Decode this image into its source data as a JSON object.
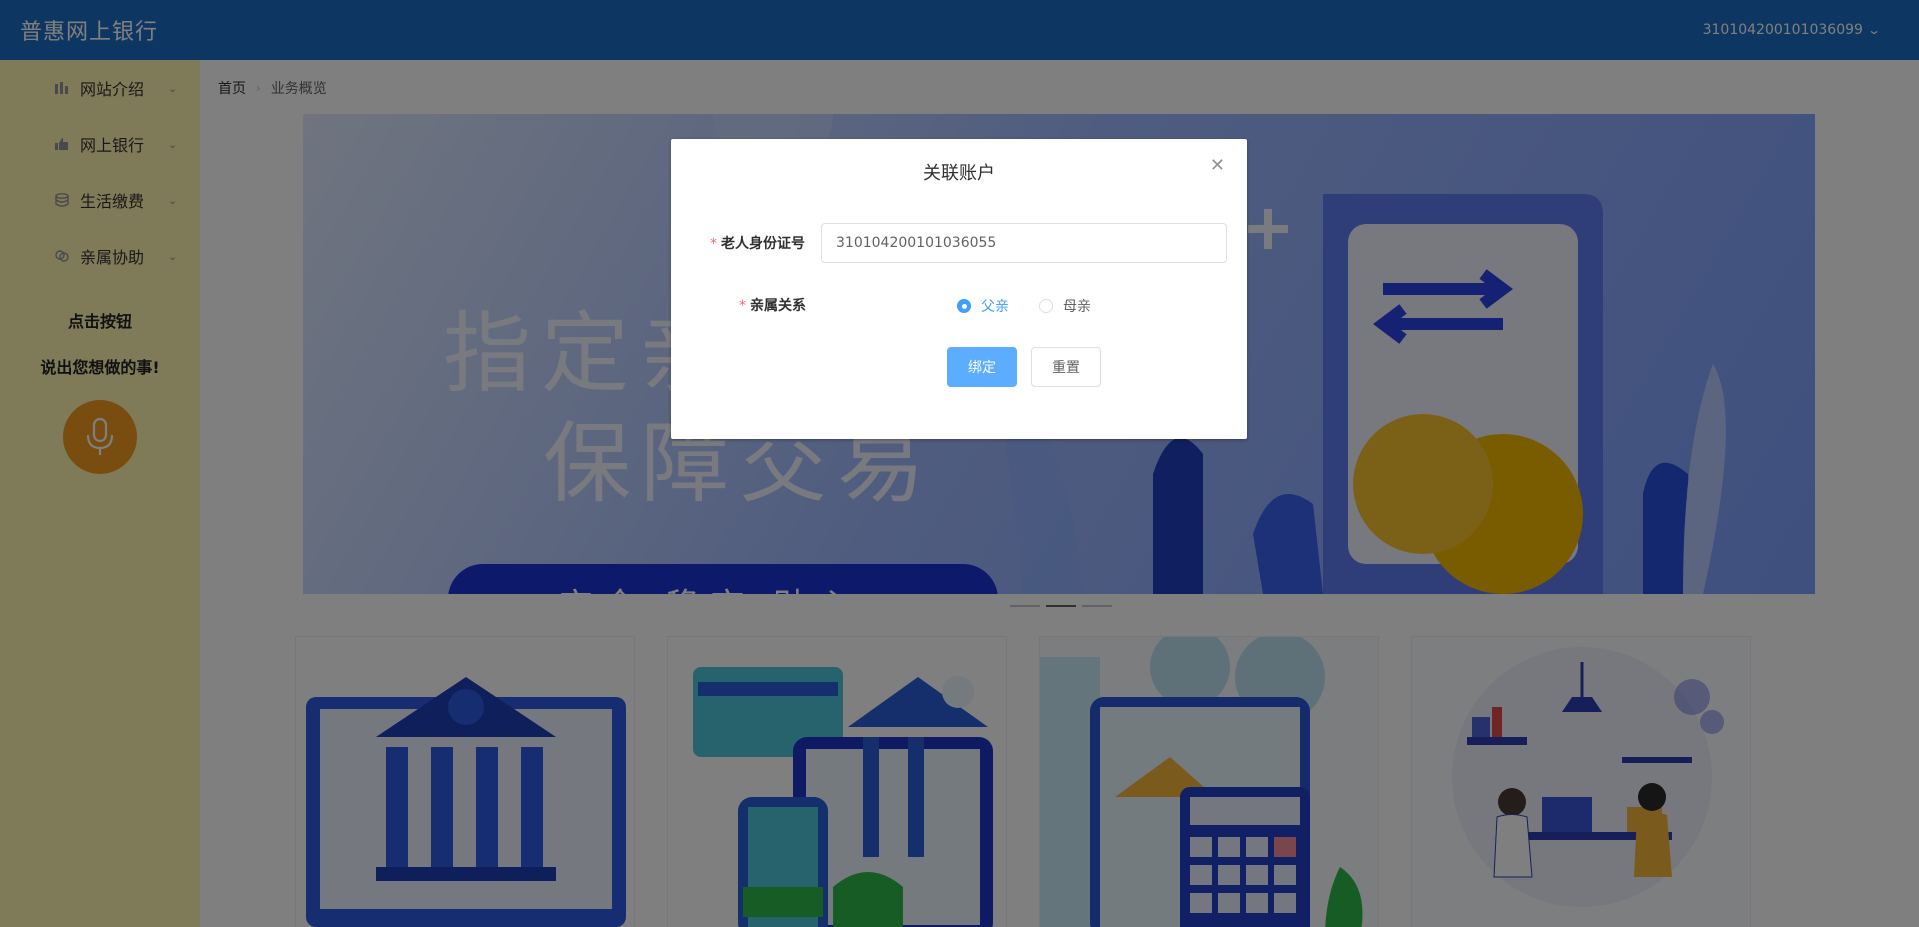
{
  "header": {
    "brand": "普惠网上银行",
    "user_id": "310104200101036099"
  },
  "sidebar": {
    "items": [
      {
        "label": "网站介绍",
        "icon": "chart-bars-icon"
      },
      {
        "label": "网上银行",
        "icon": "thumb-up-icon"
      },
      {
        "label": "生活缴费",
        "icon": "coins-stack-icon"
      },
      {
        "label": "亲属协助",
        "icon": "link-circles-icon"
      }
    ],
    "voice_title": "点击按钮",
    "voice_subtitle": "说出您想做的事!",
    "mic_icon": "microphone-icon"
  },
  "breadcrumb": {
    "home": "首页",
    "current": "业务概览"
  },
  "banner": {
    "line1": "指定亲",
    "line2": "保障交易",
    "pill": "安全 稳定 贴心"
  },
  "dialog": {
    "title": "关联账户",
    "id_label": "老人身份证号",
    "id_value": "310104200101036055",
    "relation_label": "亲属关系",
    "options": [
      "父亲",
      "母亲"
    ],
    "selected": "父亲",
    "bind_label": "绑定",
    "reset_label": "重置"
  },
  "colors": {
    "header": "#1a6fc4",
    "sidebar": "#fff7b0",
    "mic": "#f19a1e",
    "primary": "#409eff",
    "required": "#f56c6c"
  }
}
